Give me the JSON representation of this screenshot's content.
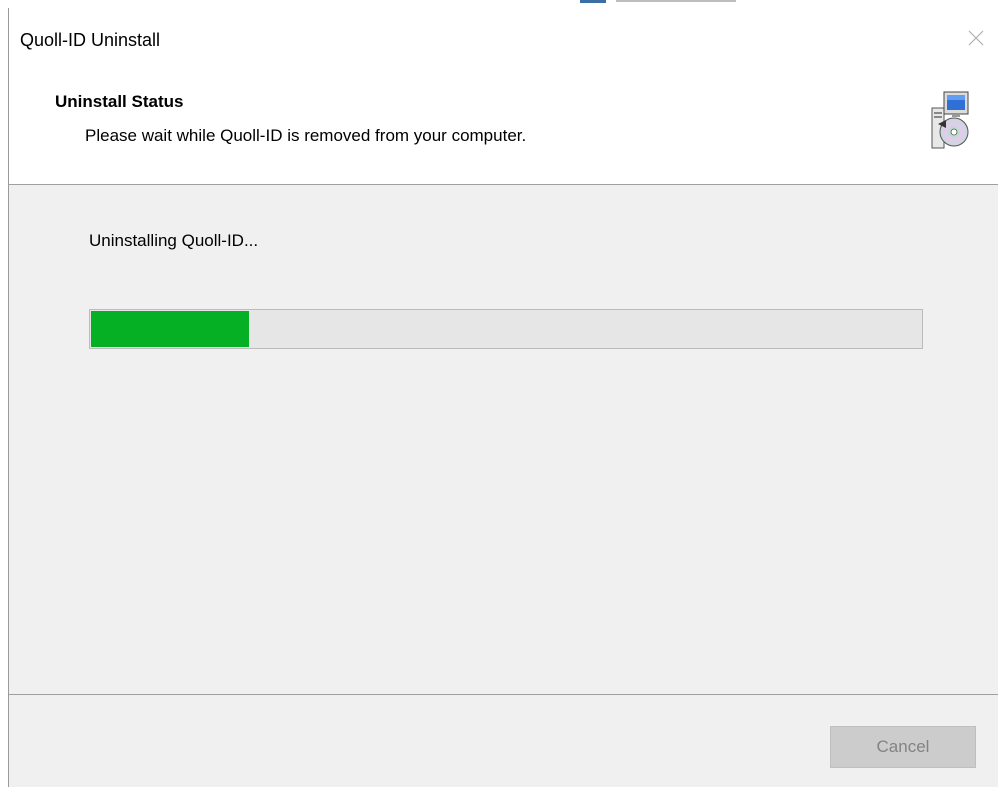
{
  "window": {
    "title": "Quoll-ID Uninstall"
  },
  "header": {
    "title": "Uninstall Status",
    "subtitle": "Please wait while Quoll-ID is removed from your computer.",
    "icon": "installer-icon"
  },
  "body": {
    "status_text": "Uninstalling Quoll-ID...",
    "progress_fraction": 0.19,
    "progress_color": "#06b025"
  },
  "footer": {
    "cancel_label": "Cancel",
    "cancel_enabled": false
  },
  "icons": {
    "close": "close-icon"
  }
}
